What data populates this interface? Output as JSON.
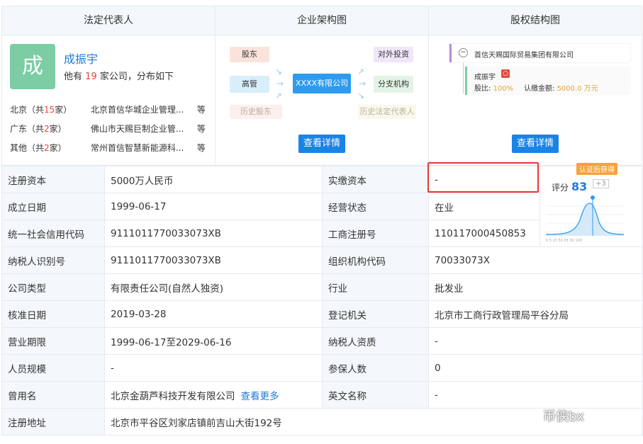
{
  "panels": {
    "legal_rep_title": "法定代表人",
    "structure_title": "企业架构图",
    "equity_title": "股权结构图"
  },
  "legal_rep": {
    "avatar": "成",
    "name": "成振宇",
    "summary_prefix": "他有",
    "company_count": "19",
    "summary_suffix": "家公司，分布如下",
    "regions": [
      {
        "region": "北京（共",
        "count": "15",
        "unit": "家）",
        "company": "北京首信华城企业管理...",
        "etc": "等"
      },
      {
        "region": "广东（共",
        "count": "2",
        "unit": "家）",
        "company": "佛山市天赐巨制企业管...",
        "etc": "等"
      },
      {
        "region": "其他（共",
        "count": "2",
        "unit": "家）",
        "company": "常州首信智慧新能源科...",
        "etc": "等"
      }
    ]
  },
  "structure": {
    "shareholder": "股东",
    "executive": "高管",
    "history_shareholder": "历史股东",
    "company": "XXXX有限公司",
    "investment": "对外投资",
    "branch": "分支机构",
    "history_rep": "历史法定代表人",
    "detail_button": "查看详情"
  },
  "equity": {
    "company": "首信天赐国际贸易集团有限公司",
    "holder": "成振宇",
    "ratio_label": "股比:",
    "ratio": "100%",
    "capital_label": "认缴金额:",
    "capital": "5000.0 万元",
    "detail_button": "查看详情"
  },
  "score": {
    "badge": "认证后获得",
    "label": "评分",
    "value": "83",
    "plus": "+3"
  },
  "info_rows": [
    {
      "l1": "注册资本",
      "v1": "5000万人民币",
      "l2": "实缴资本",
      "v2": "-"
    },
    {
      "l1": "成立日期",
      "v1": "1999-06-17",
      "l2": "经营状态",
      "v2": "在业"
    },
    {
      "l1": "统一社会信用代码",
      "v1": "9111011770033073XB",
      "l2": "工商注册号",
      "v2": "110117000450853"
    },
    {
      "l1": "纳税人识别号",
      "v1": "9111011770033073XB",
      "l2": "组织机构代码",
      "v2": "70033073X"
    },
    {
      "l1": "公司类型",
      "v1": "有限责任公司(自然人独资)",
      "l2": "行业",
      "v2": "批发业"
    },
    {
      "l1": "核准日期",
      "v1": "2019-03-28",
      "l2": "登记机关",
      "v2": "北京市工商行政管理局平谷分局"
    },
    {
      "l1": "营业期限",
      "v1": "1999-06-17至2029-06-16",
      "l2": "纳税人资质",
      "v2": "-"
    },
    {
      "l1": "人员规模",
      "v1": "-",
      "l2": "参保人数",
      "v2": "0"
    },
    {
      "l1": "曾用名",
      "v1": "北京金葫芦科技开发有限公司",
      "link": "查看更多",
      "l2": "英文名称",
      "v2": "-"
    }
  ],
  "address": {
    "label": "注册地址",
    "value": "北京市平谷区刘家店镇前吉山大街192号"
  },
  "watermark": "币侠bx",
  "colors": {
    "accent": "#1a83e6",
    "avatar": "#7ccda4",
    "highlight_border": "#e33"
  }
}
